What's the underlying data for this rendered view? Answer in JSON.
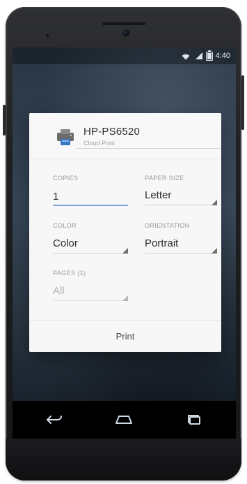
{
  "status_bar": {
    "time": "4:40",
    "icons": {
      "wifi": "wifi-icon",
      "signal": "signal-icon",
      "battery": "battery-icon"
    }
  },
  "print_dialog": {
    "printer": {
      "name": "HP-PS6520",
      "subtitle": "Cloud Print",
      "icon": "printer-icon"
    },
    "copies": {
      "label": "COPIES",
      "value": "1"
    },
    "paper_size": {
      "label": "PAPER SIZE",
      "value": "Letter"
    },
    "color": {
      "label": "COLOR",
      "value": "Color"
    },
    "orientation": {
      "label": "ORIENTATION",
      "value": "Portrait"
    },
    "pages": {
      "label": "PAGES (1)",
      "value": "All"
    },
    "print_button_label": "Print"
  },
  "nav_bar": {
    "back_icon": "back-icon",
    "home_icon": "home-icon",
    "recents_icon": "recents-icon"
  },
  "colors": {
    "accent": "#7aa7d8",
    "card_bg": "#f7f7f7",
    "text_primary": "#2b2b2b",
    "text_secondary": "#9a9a9a"
  }
}
